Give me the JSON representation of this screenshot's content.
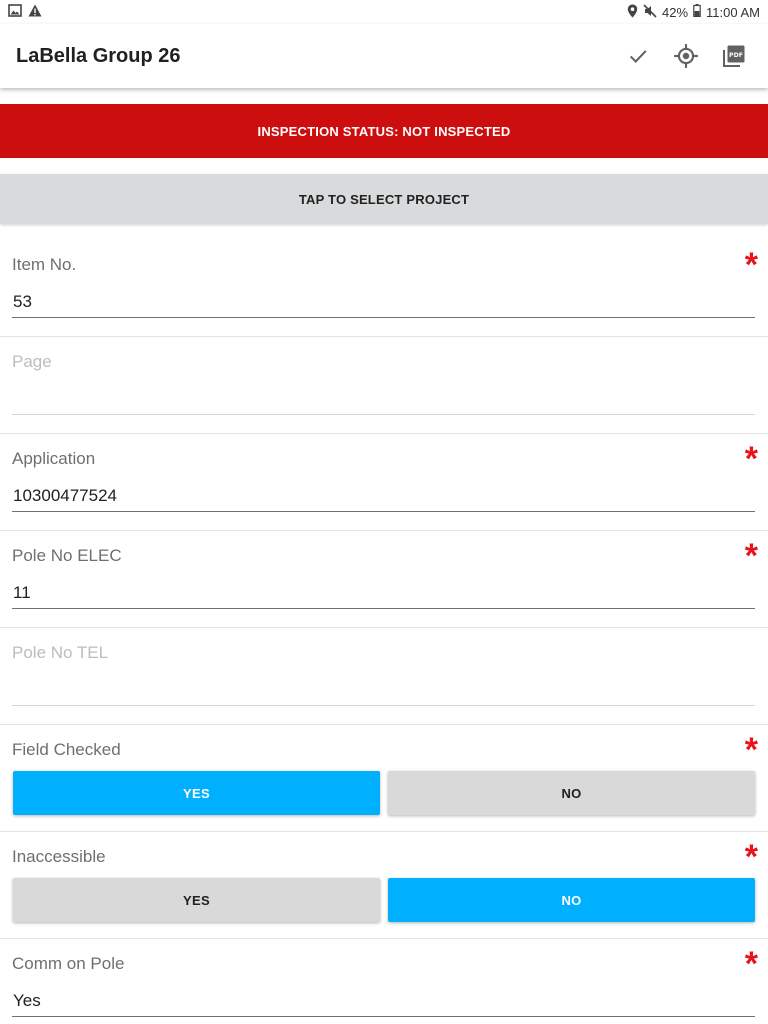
{
  "status_bar": {
    "battery": "42%",
    "time": "11:00 AM",
    "icons": [
      "image-icon",
      "warning-icon",
      "location-icon",
      "mute-icon",
      "battery-icon"
    ]
  },
  "app_bar": {
    "title": "LaBella Group 26",
    "actions": [
      "check-icon",
      "gps-target-icon",
      "pdf-icon"
    ]
  },
  "banner": {
    "text": "INSPECTION STATUS: NOT INSPECTED",
    "color": "#cc0e0e"
  },
  "select_project": {
    "label": "TAP TO SELECT PROJECT"
  },
  "colors": {
    "accent": "#00b0ff",
    "required": "#e8141c"
  },
  "fields": {
    "item_no": {
      "label": "Item No.",
      "value": "53",
      "required": true
    },
    "page": {
      "label": "Page",
      "value": "",
      "required": false
    },
    "application": {
      "label": "Application",
      "value": "10300477524",
      "required": true
    },
    "pole_no_elec": {
      "label": "Pole No ELEC",
      "value": "11",
      "required": true
    },
    "pole_no_tel": {
      "label": "Pole No TEL",
      "value": "",
      "required": false
    },
    "field_checked": {
      "label": "Field Checked",
      "yes": "YES",
      "no": "NO",
      "selected": "YES",
      "required": true
    },
    "inaccessible": {
      "label": "Inaccessible",
      "yes": "YES",
      "no": "NO",
      "selected": "NO",
      "required": true
    },
    "comm_on_pole": {
      "label": "Comm on Pole",
      "value": "Yes",
      "required": true
    }
  }
}
